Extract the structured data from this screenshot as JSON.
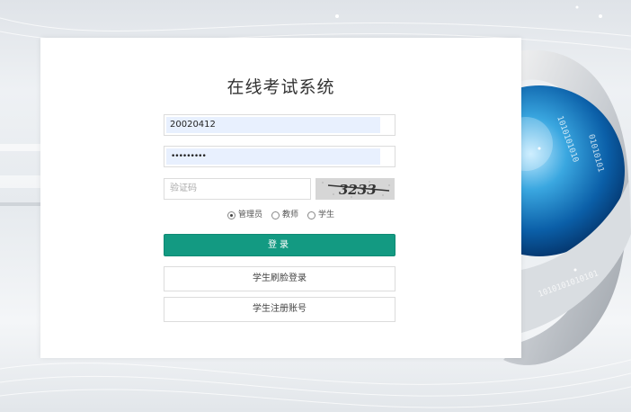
{
  "title": "在线考试系统",
  "username": {
    "value": "20020412"
  },
  "password": {
    "masked": "•••••••••"
  },
  "captcha": {
    "placeholder": "验证码",
    "image_text": "3233"
  },
  "roles": [
    {
      "label": "管理员",
      "checked": true
    },
    {
      "label": "教师",
      "checked": false
    },
    {
      "label": "学生",
      "checked": false
    }
  ],
  "buttons": {
    "login": "登录",
    "face_login": "学生刷脸登录",
    "register": "学生注册账号"
  },
  "colors": {
    "primary": "#139a82",
    "card": "#ffffff",
    "autofill": "#e8f0fe"
  }
}
